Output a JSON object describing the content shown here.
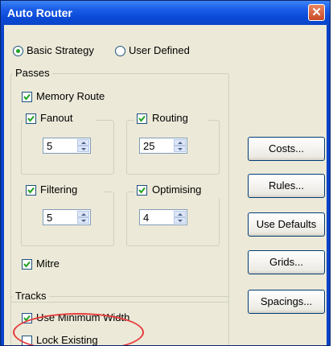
{
  "window": {
    "title": "Auto Router",
    "close_glyph": "✕"
  },
  "strategy": {
    "basic_label": "Basic Strategy",
    "user_label": "User Defined",
    "selected": "Basic Strategy"
  },
  "passes": {
    "group_label": "Passes",
    "memory_route": {
      "label": "Memory Route",
      "checked": true
    },
    "fanout": {
      "label": "Fanout",
      "checked": true,
      "value": "5"
    },
    "routing": {
      "label": "Routing",
      "checked": true,
      "value": "25"
    },
    "filtering": {
      "label": "Filtering",
      "checked": true,
      "value": "5"
    },
    "optimising": {
      "label": "Optimising",
      "checked": true,
      "value": "4"
    },
    "mitre": {
      "label": "Mitre",
      "checked": true
    }
  },
  "tracks": {
    "group_label": "Tracks",
    "use_min_width": {
      "label": "Use Minimum Width",
      "checked": true
    },
    "lock_existing": {
      "label": "Lock Existing",
      "checked": false
    }
  },
  "buttons": {
    "costs": "Costs...",
    "rules": "Rules...",
    "use_defaults": "Use Defaults",
    "grids": "Grids...",
    "spacings": "Spacings..."
  },
  "annotation": {
    "color": "#e63a3a"
  },
  "colors": {
    "titlebar": "#0a49d6",
    "dialog_bg": "#ece9d8",
    "check": "#21a121"
  }
}
